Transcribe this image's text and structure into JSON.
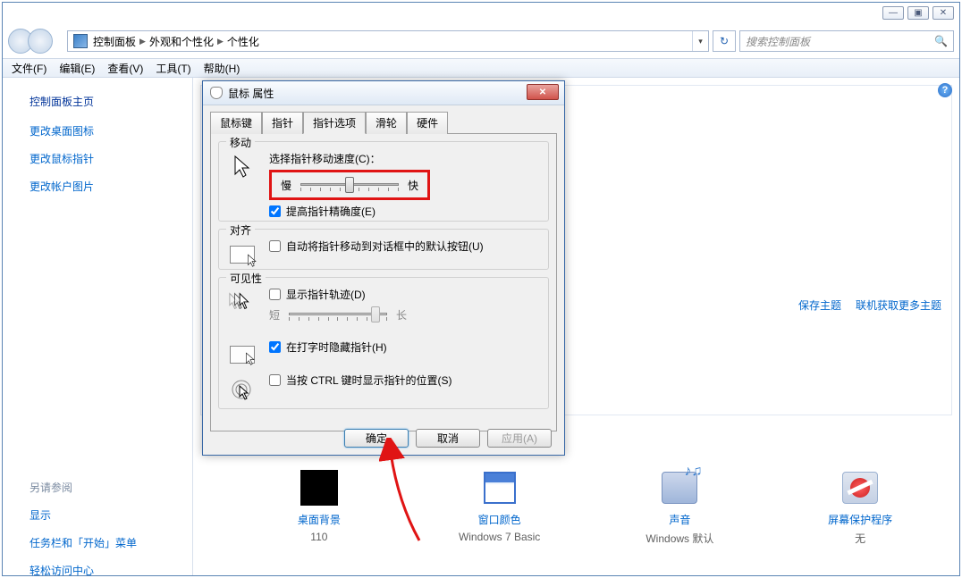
{
  "window": {
    "controls": {
      "min": "—",
      "max": "▣",
      "close": "✕"
    }
  },
  "address": {
    "parts": [
      "控制面板",
      "外观和个性化",
      "个性化"
    ],
    "dropdown_glyph": "▾",
    "refresh_glyph": "↻"
  },
  "search": {
    "placeholder": "搜索控制面板",
    "icon": "🔍"
  },
  "menu": {
    "file": "文件(F)",
    "edit": "编辑(E)",
    "view": "查看(V)",
    "tools": "工具(T)",
    "help": "帮助(H)"
  },
  "sidebar": {
    "home": "控制面板主页",
    "links": [
      "更改桌面图标",
      "更改鼠标指针",
      "更改帐户图片"
    ],
    "see_also_label": "另请参阅",
    "see_also": [
      "显示",
      "任务栏和「开始」菜单",
      "轻松访问中心"
    ]
  },
  "main": {
    "help_glyph": "?",
    "links": {
      "save_theme": "保存主题",
      "get_more": "联机获取更多主题"
    },
    "tiles": [
      {
        "title": "桌面背景",
        "sub": "110"
      },
      {
        "title": "窗口颜色",
        "sub": "Windows 7 Basic"
      },
      {
        "title": "声音",
        "sub": "Windows 默认"
      },
      {
        "title": "屏幕保护程序",
        "sub": "无"
      }
    ]
  },
  "dialog": {
    "title": "鼠标 属性",
    "close_glyph": "✕",
    "tabs": [
      "鼠标键",
      "指针",
      "指针选项",
      "滑轮",
      "硬件"
    ],
    "active_tab": "指针选项",
    "groups": {
      "move": {
        "legend": "移动",
        "speed_label": "选择指针移动速度(C)：",
        "slow": "慢",
        "fast": "快",
        "precision": "提高指针精确度(E)",
        "precision_checked": true,
        "slider_value": 5,
        "slider_max": 10
      },
      "snap": {
        "legend": "对齐",
        "label": "自动将指针移动到对话框中的默认按钮(U)",
        "checked": false
      },
      "visibility": {
        "legend": "可见性",
        "trails_label": "显示指针轨迹(D)",
        "trails_checked": false,
        "short": "短",
        "long": "长",
        "trail_slider_value": 9,
        "trail_slider_max": 10,
        "hide_typing_label": "在打字时隐藏指针(H)",
        "hide_typing_checked": true,
        "ctrl_locate_label": "当按 CTRL 键时显示指针的位置(S)",
        "ctrl_locate_checked": false
      }
    },
    "buttons": {
      "ok": "确定",
      "cancel": "取消",
      "apply": "应用(A)"
    }
  }
}
